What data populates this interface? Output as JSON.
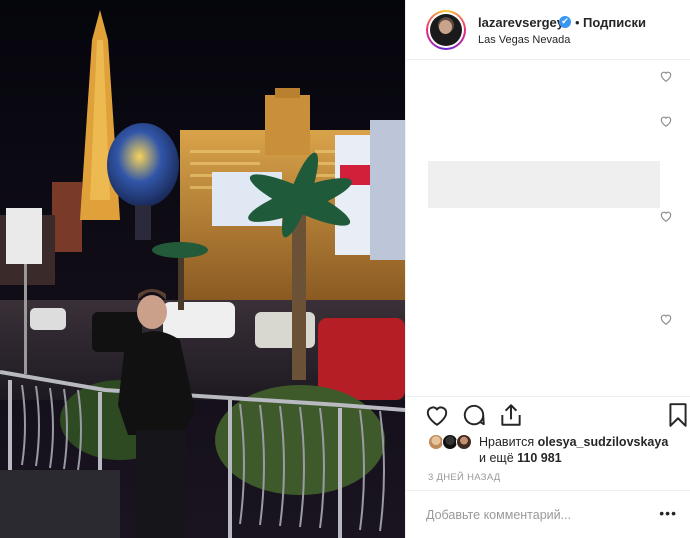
{
  "post": {
    "username": "lazarevsergey",
    "verified_icon": "✔",
    "separator": "•",
    "follow_label": "Подписки",
    "location": "Las Vegas Nevada"
  },
  "comment_icons": [
    "heart-icon",
    "heart-icon",
    "heart-icon",
    "heart-icon"
  ],
  "actions": {
    "like_icon": "heart-outline-icon",
    "comment_icon": "comment-bubble-icon",
    "share_icon": "share-icon",
    "save_icon": "bookmark-icon"
  },
  "likes": {
    "prefix": "Нравится ",
    "user": "olesya_sudzilovskaya",
    "middle": " и ещё ",
    "count": "110 981"
  },
  "timestamp": "3 дней назад",
  "comment": {
    "placeholder": "Добавьте комментарий...",
    "more_label": "•••"
  },
  "colors": {
    "accent": "#3897f0",
    "border": "#efefef",
    "muted": "#999999",
    "text": "#262626"
  }
}
